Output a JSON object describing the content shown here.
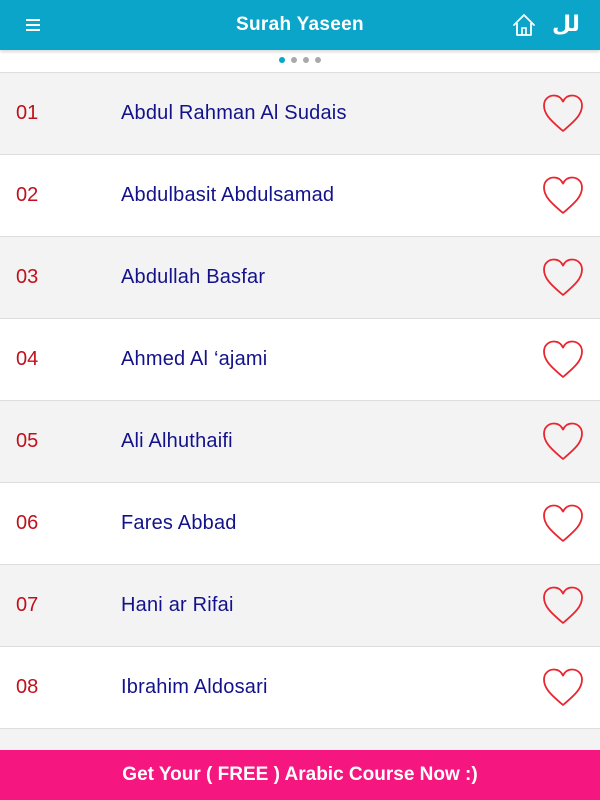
{
  "header": {
    "title": "Surah Yaseen",
    "menu_icon": "hamburger-menu-icon",
    "home_icon": "home-icon",
    "lang_label": "لل",
    "color": "#0aa5c8"
  },
  "pager": {
    "total": 4,
    "active_index": 0
  },
  "reciters": [
    {
      "num": "01",
      "name": "Abdul Rahman Al Sudais"
    },
    {
      "num": "02",
      "name": "Abdulbasit Abdulsamad"
    },
    {
      "num": "03",
      "name": "Abdullah Basfar"
    },
    {
      "num": "04",
      "name": "Ahmed Al ‘ajami"
    },
    {
      "num": "05",
      "name": "Ali Alhuthaifi"
    },
    {
      "num": "06",
      "name": "Fares Abbad"
    },
    {
      "num": "07",
      "name": "Hani ar Rifai"
    },
    {
      "num": "08",
      "name": "Ibrahim Aldosari"
    },
    {
      "num": "",
      "name": ""
    }
  ],
  "favorite_icon": "heart-outline-icon",
  "colors": {
    "number": "#c0101b",
    "name": "#13128a",
    "heart": "#e8262f",
    "banner": "#f5177f"
  },
  "banner": {
    "text": "Get Your ( FREE ) Arabic Course Now :)"
  }
}
